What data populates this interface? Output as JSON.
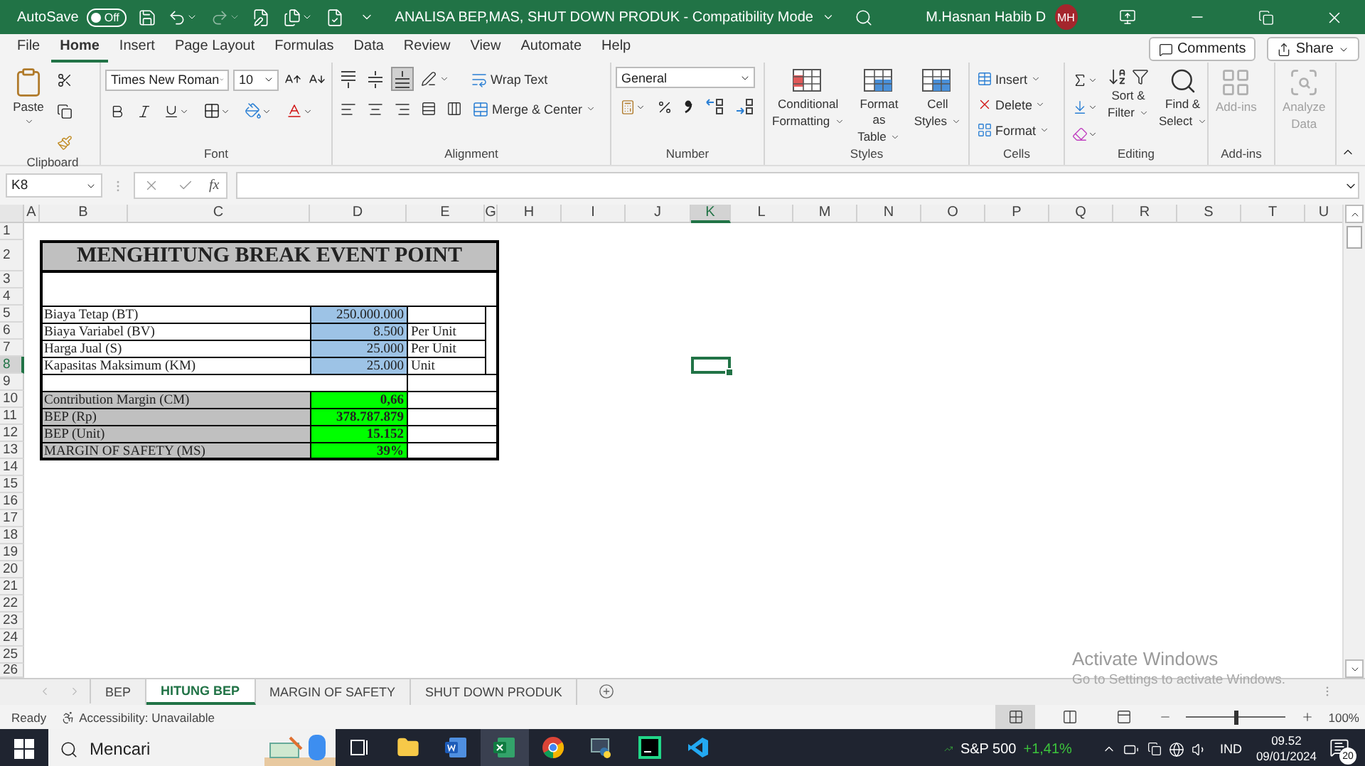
{
  "title_bar": {
    "autosave_label": "AutoSave",
    "autosave": {
      "label": "Off",
      "on": false
    },
    "document_title": "ANALISA BEP,MAS, SHUT DOWN PRODUK  -  Compatibility Mode",
    "user_name": "M.Hasnan Habib D",
    "user_initials": "MH"
  },
  "menu_tabs": [
    {
      "label": "File",
      "selected": false
    },
    {
      "label": "Home",
      "selected": true
    },
    {
      "label": "Insert",
      "selected": false
    },
    {
      "label": "Page Layout",
      "selected": false
    },
    {
      "label": "Formulas",
      "selected": false
    },
    {
      "label": "Data",
      "selected": false
    },
    {
      "label": "Review",
      "selected": false
    },
    {
      "label": "View",
      "selected": false
    },
    {
      "label": "Automate",
      "selected": false
    },
    {
      "label": "Help",
      "selected": false
    }
  ],
  "comments_button": "Comments",
  "share_button": "Share",
  "ribbon": {
    "clipboard": {
      "paste": "Paste",
      "group_label": "Clipboard"
    },
    "font": {
      "font_name": "Times New Roman",
      "font_size": "10",
      "group_label": "Font"
    },
    "alignment": {
      "vertical": [
        {
          "kind": "top",
          "selected": false
        },
        {
          "kind": "middle",
          "selected": false
        },
        {
          "kind": "bottom",
          "selected": true
        }
      ],
      "wrap_text": "Wrap Text",
      "merge_center": "Merge & Center",
      "group_label": "Alignment"
    },
    "number": {
      "format": "General",
      "group_label": "Number"
    },
    "styles": {
      "buttons": [
        {
          "kind": "conditional",
          "lines": [
            "Conditional",
            "Formatting"
          ]
        },
        {
          "kind": "table",
          "lines": [
            "Format as",
            "Table"
          ]
        },
        {
          "kind": "cell",
          "lines": [
            "Cell",
            "Styles"
          ]
        }
      ],
      "group_label": "Styles"
    },
    "cells": {
      "buttons": [
        {
          "kind": "insert",
          "label": "Insert"
        },
        {
          "kind": "delete",
          "label": "Delete"
        },
        {
          "kind": "format",
          "label": "Format"
        }
      ],
      "group_label": "Cells"
    },
    "editing": {
      "sort_filter": [
        "Sort &",
        "Filter"
      ],
      "find_select": [
        "Find &",
        "Select"
      ],
      "group_label": "Editing"
    },
    "add_ins": {
      "lines": [
        "Add-ins"
      ],
      "disabled": true,
      "group_label": "Add-ins"
    },
    "analyze": {
      "lines": [
        "Analyze",
        "Data"
      ],
      "disabled": true
    }
  },
  "formula_bar": {
    "name_box": "K8",
    "fx_label": "fx"
  },
  "sheet": {
    "columns": [
      {
        "label": "A",
        "selected": false
      },
      {
        "label": "B",
        "selected": false
      },
      {
        "label": "C",
        "selected": false
      },
      {
        "label": "D",
        "selected": false
      },
      {
        "label": "E",
        "selected": false
      },
      {
        "label": "G",
        "selected": false
      },
      {
        "label": "H",
        "selected": false
      },
      {
        "label": "I",
        "selected": false
      },
      {
        "label": "J",
        "selected": false
      },
      {
        "label": "K",
        "selected": true
      },
      {
        "label": "L",
        "selected": false
      },
      {
        "label": "M",
        "selected": false
      },
      {
        "label": "N",
        "selected": false
      },
      {
        "label": "O",
        "selected": false
      },
      {
        "label": "P",
        "selected": false
      },
      {
        "label": "Q",
        "selected": false
      },
      {
        "label": "R",
        "selected": false
      },
      {
        "label": "S",
        "selected": false
      },
      {
        "label": "T",
        "selected": false
      },
      {
        "label": "U",
        "selected": false
      }
    ],
    "rows": [
      {
        "label": "1",
        "selected": false
      },
      {
        "label": "2",
        "selected": false
      },
      {
        "label": "3",
        "selected": false
      },
      {
        "label": "4",
        "selected": false
      },
      {
        "label": "5",
        "selected": false
      },
      {
        "label": "6",
        "selected": false
      },
      {
        "label": "7",
        "selected": false
      },
      {
        "label": "8",
        "selected": true
      },
      {
        "label": "9",
        "selected": false
      },
      {
        "label": "10",
        "selected": false
      },
      {
        "label": "11",
        "selected": false
      },
      {
        "label": "12",
        "selected": false
      },
      {
        "label": "13",
        "selected": false
      },
      {
        "label": "14",
        "selected": false
      },
      {
        "label": "15",
        "selected": false
      },
      {
        "label": "16",
        "selected": false
      },
      {
        "label": "17",
        "selected": false
      },
      {
        "label": "18",
        "selected": false
      },
      {
        "label": "19",
        "selected": false
      },
      {
        "label": "20",
        "selected": false
      },
      {
        "label": "21",
        "selected": false
      },
      {
        "label": "22",
        "selected": false
      },
      {
        "label": "23",
        "selected": false
      },
      {
        "label": "24",
        "selected": false
      },
      {
        "label": "25",
        "selected": false
      },
      {
        "label": "26",
        "selected": false
      }
    ],
    "title": "MENGHITUNG BREAK EVENT POINT",
    "inputs": [
      {
        "label": "Biaya  Tetap  (BT)",
        "value": "250.000.000"
      },
      {
        "label": "Biaya Variabel (BV)",
        "value": "8.500",
        "unit": "Per Unit"
      },
      {
        "label": "Harga Jual (S)",
        "value": "25.000",
        "unit": "Per Unit"
      },
      {
        "label": "Kapasitas Maksimum (KM)",
        "value": "25.000",
        "unit": "Unit"
      }
    ],
    "results": [
      {
        "label": "Contribution Margin (CM)",
        "value": "0,66"
      },
      {
        "label": "BEP (Rp)",
        "value": "378.787.879"
      },
      {
        "label": "BEP (Unit)",
        "value": "15.152"
      },
      {
        "label": "MARGIN OF SAFETY (MS)",
        "value": "39%"
      }
    ]
  },
  "sheet_tabs": [
    {
      "label": "BEP",
      "selected": false
    },
    {
      "label": "HITUNG BEP",
      "selected": true
    },
    {
      "label": "MARGIN OF SAFETY",
      "selected": false
    },
    {
      "label": "SHUT DOWN PRODUK",
      "selected": false
    }
  ],
  "status_bar": {
    "ready": "Ready",
    "accessibility": "Accessibility: Unavailable",
    "views": [
      {
        "kind": "normal",
        "selected": true
      },
      {
        "kind": "page_layout",
        "selected": false
      },
      {
        "kind": "page_break",
        "selected": false
      }
    ],
    "zoom": {
      "level": 0.5,
      "label": "100%"
    }
  },
  "activation_notice": {
    "title": "Activate Windows",
    "hint": "Go to Settings to activate Windows."
  },
  "taskbar": {
    "search_placeholder": "Mencari",
    "apps": [
      {
        "kind": "taskview",
        "active": false
      },
      {
        "kind": "explorer",
        "active": false
      },
      {
        "kind": "word",
        "active": false
      },
      {
        "kind": "excel",
        "active": true
      },
      {
        "kind": "chrome",
        "active": false
      },
      {
        "kind": "python",
        "active": false
      },
      {
        "kind": "pycharm",
        "active": false
      },
      {
        "kind": "vscode",
        "active": false
      }
    ],
    "stock": {
      "name": "S&P 500",
      "change": "+1,41%"
    },
    "language": "IND",
    "time": "09.52",
    "date": "09/01/2024",
    "notifications": "20"
  }
}
